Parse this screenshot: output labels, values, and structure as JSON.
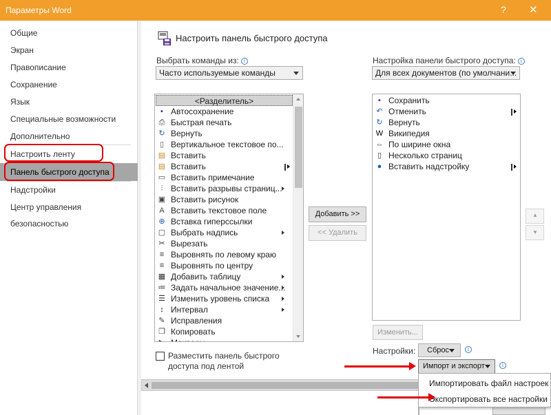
{
  "window": {
    "title": "Параметры Word",
    "help_glyph": "?",
    "close_glyph": "✕"
  },
  "sidebar": {
    "items": [
      {
        "label": "Общие"
      },
      {
        "label": "Экран"
      },
      {
        "label": "Правописание"
      },
      {
        "label": "Сохранение"
      },
      {
        "label": "Язык"
      },
      {
        "label": "Специальные возможности"
      },
      {
        "label": "Дополнительно"
      },
      {
        "label": "Настроить ленту"
      },
      {
        "label": "Панель быстрого доступа"
      },
      {
        "label": "Надстройки"
      },
      {
        "label": "Центр управления безопасностью"
      }
    ],
    "selected": "Панель быстрого доступа",
    "highlight_color": "#e00000"
  },
  "header": {
    "title": "Настроить панель быстрого доступа",
    "icon": "quick-access-toolbar-icon"
  },
  "left": {
    "label": "Выбрать команды из:",
    "combo_value": "Часто используемые команды",
    "commands": [
      {
        "label": "<Разделитель>",
        "icon": "",
        "sub": false,
        "pane": false,
        "separator": true
      },
      {
        "label": "Автосохранение",
        "icon": "save-icon",
        "sub": false,
        "pane": false
      },
      {
        "label": "Быстрая печать",
        "icon": "quick-print-icon",
        "sub": false,
        "pane": false
      },
      {
        "label": "Вернуть",
        "icon": "redo-icon",
        "sub": false,
        "pane": false
      },
      {
        "label": "Вертикальное текстовое по...",
        "icon": "vertical-textbox-icon",
        "sub": false,
        "pane": false
      },
      {
        "label": "Вставить",
        "icon": "paste-icon",
        "sub": false,
        "pane": false
      },
      {
        "label": "Вставить",
        "icon": "paste-options-icon",
        "sub": false,
        "pane": true
      },
      {
        "label": "Вставить примечание",
        "icon": "comment-icon",
        "sub": false,
        "pane": false
      },
      {
        "label": "Вставить разрывы страниц...",
        "icon": "page-break-icon",
        "sub": true,
        "pane": false
      },
      {
        "label": "Вставить рисунок",
        "icon": "picture-icon",
        "sub": false,
        "pane": false
      },
      {
        "label": "Вставить текстовое поле",
        "icon": "textbox-icon",
        "sub": false,
        "pane": false
      },
      {
        "label": "Вставка гиперссылки",
        "icon": "hyperlink-icon",
        "sub": false,
        "pane": false
      },
      {
        "label": "Выбрать надпись",
        "icon": "select-caption-icon",
        "sub": true,
        "pane": false
      },
      {
        "label": "Вырезать",
        "icon": "scissors-icon",
        "sub": false,
        "pane": false
      },
      {
        "label": "Выровнять по левому краю",
        "icon": "align-left-icon",
        "sub": false,
        "pane": false
      },
      {
        "label": "Выровнять по центру",
        "icon": "align-center-icon",
        "sub": false,
        "pane": false
      },
      {
        "label": "Добавить таблицу",
        "icon": "table-icon",
        "sub": true,
        "pane": false
      },
      {
        "label": "Задать начальное значение...",
        "icon": "numbering-icon",
        "sub": true,
        "pane": false
      },
      {
        "label": "Изменить уровень списка",
        "icon": "list-level-icon",
        "sub": true,
        "pane": false
      },
      {
        "label": "Интервал",
        "icon": "line-spacing-icon",
        "sub": true,
        "pane": false
      },
      {
        "label": "Исправления",
        "icon": "track-changes-icon",
        "sub": false,
        "pane": false
      },
      {
        "label": "Копировать",
        "icon": "copy-icon",
        "sub": false,
        "pane": false
      },
      {
        "label": "Макросы",
        "icon": "macros-icon",
        "sub": false,
        "pane": false
      }
    ],
    "checkbox_label": "Разместить панель быстрого доступа под лентой"
  },
  "middle": {
    "add_label": "Добавить >>",
    "remove_label": "<< Удалить"
  },
  "right": {
    "label": "Настройка панели быстрого доступа:",
    "combo_value": "Для всех документов (по умолчани...",
    "commands": [
      {
        "label": "Сохранить",
        "icon": "save-icon",
        "pane": false
      },
      {
        "label": "Отменить",
        "icon": "undo-icon",
        "pane": true
      },
      {
        "label": "Вернуть",
        "icon": "redo-icon",
        "pane": false
      },
      {
        "label": "Википедия",
        "icon": "wikipedia-icon",
        "pane": false
      },
      {
        "label": "По ширине окна",
        "icon": "page-width-icon",
        "pane": false
      },
      {
        "label": "Несколько страниц",
        "icon": "multiple-pages-icon",
        "pane": false
      },
      {
        "label": "Вставить надстройку",
        "icon": "add-in-icon",
        "pane": true
      }
    ],
    "modify_label": "Изменить...",
    "settings_label": "Настройки:",
    "reset_label": "Сброс",
    "import_export_label": "Импорт и экспорт",
    "move_up_glyph": "▲",
    "move_down_glyph": "▼"
  },
  "dropdown_menu": {
    "items": [
      {
        "label": "Импортировать файл настроек"
      },
      {
        "label": "Экспортировать все настройки"
      }
    ]
  },
  "colors": {
    "title_bar": "#f19e2b",
    "selection": "#a6a6a6",
    "annotation": "#e00000"
  }
}
